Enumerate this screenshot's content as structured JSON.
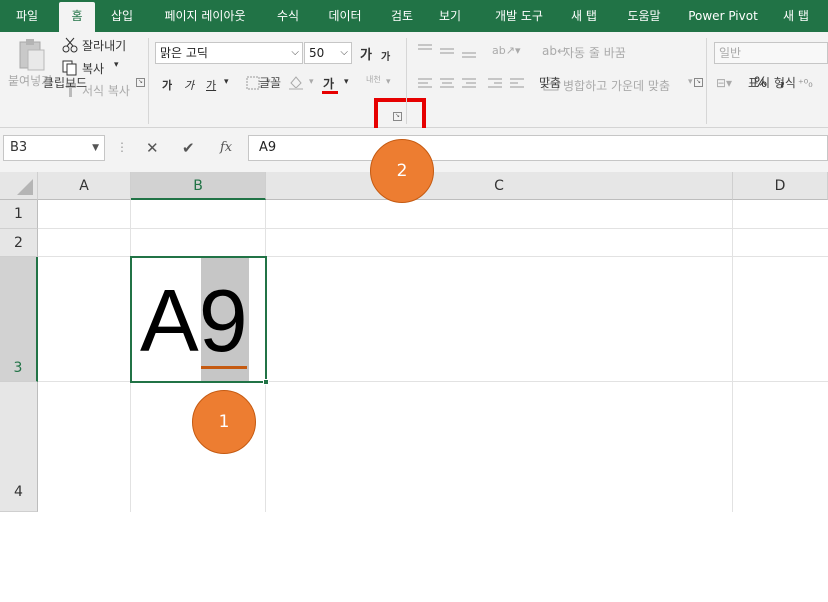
{
  "tabs": [
    "파일",
    "홈",
    "삽입",
    "페이지 레이아웃",
    "수식",
    "데이터",
    "검토",
    "보기",
    "개발 도구",
    "새 탭",
    "도움말",
    "Power Pivot",
    "새 탭"
  ],
  "active_tab": "홈",
  "clipboard": {
    "paste_label": "붙여넣기",
    "cut_label": "잘라내기",
    "copy_label": "복사",
    "format_painter_label": "서식 복사",
    "group_label": "클립보드"
  },
  "font": {
    "name": "맑은 고딕",
    "size": "50",
    "grow_glyph": "가",
    "shrink_glyph": "가",
    "bold_glyph": "가",
    "italic_glyph": "가",
    "underline_glyph": "가",
    "font_color_glyph": "가",
    "phonetic_label": "내천",
    "group_label": "글꼴"
  },
  "alignment": {
    "wrap_text_label": "자동 줄 바꿈",
    "merge_label": "병합하고 가운데 맞춤",
    "group_label": "맞춤"
  },
  "number": {
    "format": "일반",
    "percent": "%",
    "comma": ",",
    "group_label": "표시 형식"
  },
  "formula_bar": {
    "name_box": "B3",
    "cancel": "✕",
    "enter": "✔",
    "fx": "fx",
    "value": "A9"
  },
  "columns": [
    "A",
    "B",
    "C",
    "D"
  ],
  "rows": [
    "1",
    "2",
    "3",
    "4"
  ],
  "cell_b3": {
    "normal_text": "A",
    "selected_text": "9"
  },
  "callouts": [
    "1",
    "2"
  ],
  "colors": {
    "excel_green": "#217346",
    "callout_orange": "#ED7D31",
    "highlight_red": "#E60000"
  }
}
